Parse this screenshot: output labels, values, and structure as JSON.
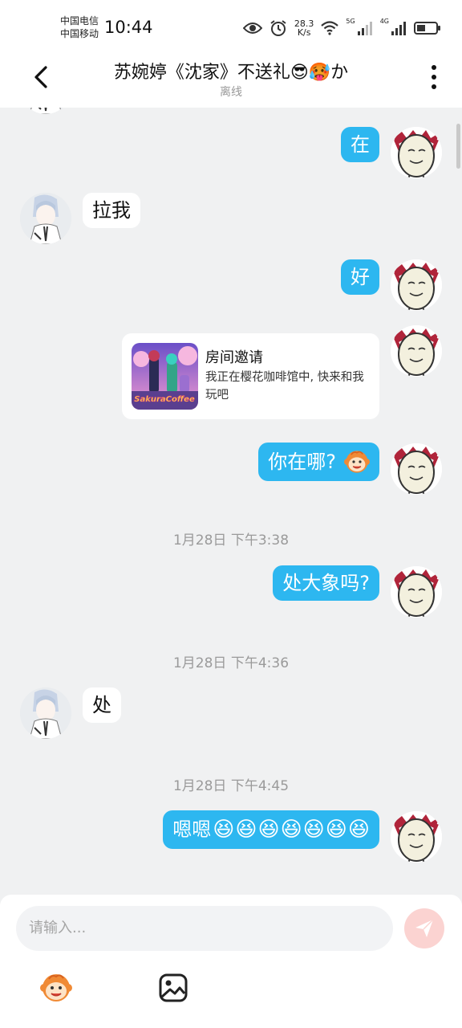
{
  "status_bar": {
    "carrier1": "中国电信",
    "carrier2": "中国移动",
    "time": "10:44",
    "net_speed_value": "28.3",
    "net_speed_unit": "K/s",
    "wifi_badge": "5G",
    "cell_badge": "4G"
  },
  "header": {
    "title": "苏婉婷《沈家》不送礼😎🥵か",
    "subtitle": "离线"
  },
  "messages": [
    {
      "from": "me",
      "text": "在"
    },
    {
      "from": "other",
      "text": "拉我"
    },
    {
      "from": "me",
      "text": "好"
    },
    {
      "from": "me",
      "type": "card",
      "title": "房间邀请",
      "desc": "我正在樱花咖啡馆中, 快来和我玩吧",
      "thumb_label": "SakuraCoffee"
    },
    {
      "from": "me",
      "text": "你在哪?",
      "emoji": "grin-monkey"
    },
    {
      "type": "time",
      "text": "1月28日 下午3:38"
    },
    {
      "from": "me",
      "text": "处大象吗?"
    },
    {
      "type": "time",
      "text": "1月28日 下午4:36"
    },
    {
      "from": "other",
      "text": "处"
    },
    {
      "type": "time",
      "text": "1月28日 下午4:45"
    },
    {
      "from": "me",
      "text": "嗯嗯",
      "emoji_repeat": 7,
      "emoji_char": "😆"
    }
  ],
  "input": {
    "placeholder": "请输入..."
  },
  "icons": {
    "back": "chevron-left-icon",
    "more": "more-vertical-icon",
    "send": "send-icon",
    "emoji_tool": "monkey-emoji-icon",
    "image_tool": "image-icon"
  },
  "colors": {
    "my_bubble": "#2db7f0",
    "other_bubble": "#ffffff",
    "background": "#f0f1f2",
    "send_button": "#fbd3d1"
  }
}
